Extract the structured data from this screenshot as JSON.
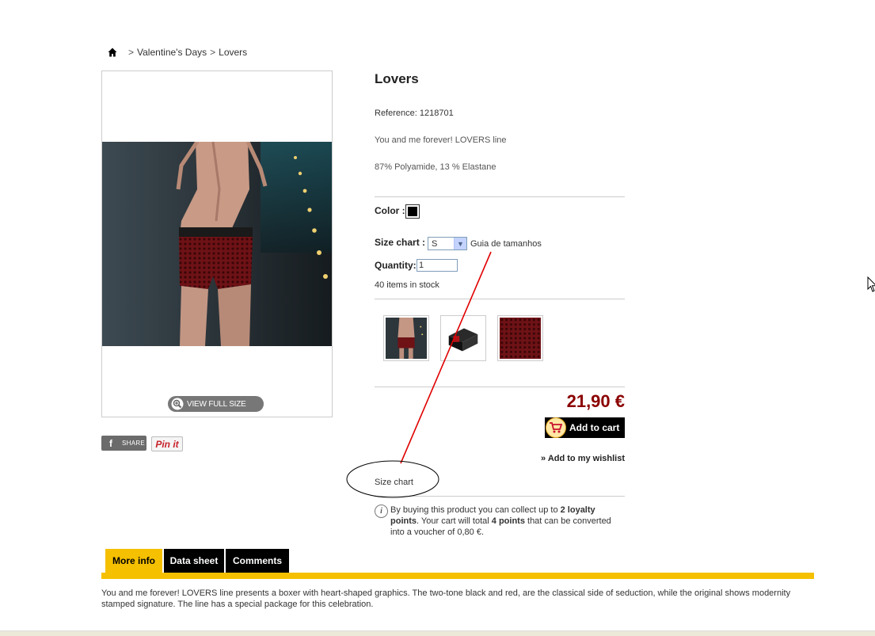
{
  "breadcrumb": {
    "separator": ">",
    "items": [
      "Valentine's Days",
      "Lovers"
    ]
  },
  "gallery": {
    "view_full_size": "VIEW FULL SIZE"
  },
  "social": {
    "share": "SHARE",
    "pinit": "Pin it"
  },
  "product": {
    "title": "Lovers",
    "reference": "Reference: 1218701",
    "short_description": "You and me forever! LOVERS line",
    "composition": "87% Polyamide, 13 % Elastane",
    "color_label": "Color :",
    "color_value": "#000000",
    "size_label": "Size chart :",
    "size_selected": "S",
    "size_guide_link": "Guia de tamanhos",
    "quantity_label": "Quantity:",
    "quantity_value": "1",
    "stock": "40 items in stock",
    "price": "21,90 €",
    "add_to_cart": "Add to cart",
    "wishlist": "» Add to my wishlist",
    "size_chart_link": "Size chart"
  },
  "loyalty": {
    "part1": "By buying this product you can collect up to ",
    "points": "2 loyalty points",
    "part2": ". Your cart will total ",
    "total": "4 points",
    "part3": " that can be converted into a voucher of 0,80 €."
  },
  "tabs": [
    "More info",
    "Data sheet",
    "Comments"
  ],
  "more_info": "You and me forever! LOVERS line presents a boxer with heart-shaped graphics. The two-tone black and red, are the classical side of seduction, while the original shows modernity stamped signature. The line has a special package for this celebration.",
  "colors": {
    "accent_yellow": "#f5c000",
    "price_red": "#8b0000",
    "annotation_red": "#e00000"
  }
}
